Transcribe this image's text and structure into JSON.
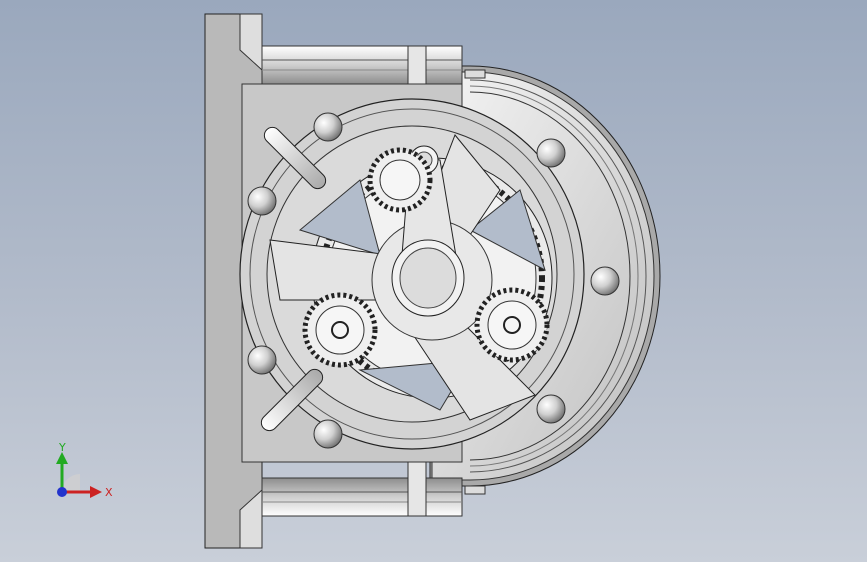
{
  "viewport": {
    "background_top": "#9aa8bd",
    "background_bottom": "#c9cfd9"
  },
  "triad": {
    "x_label": "X",
    "y_label": "Y",
    "x_color": "#cc2222",
    "y_color": "#22aa22",
    "z_color": "#2233cc"
  }
}
